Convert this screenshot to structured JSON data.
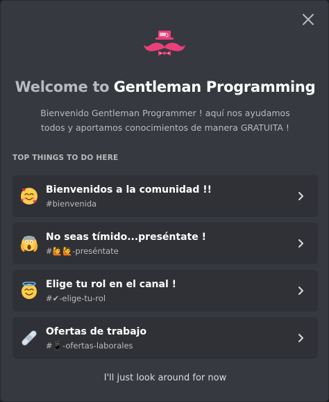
{
  "dialog": {
    "close_icon": "close-icon",
    "logo_icon": "gentleman-mustache-tophat-logo",
    "title_prefix": "Welcome to",
    "title_server": "Gentleman Programming",
    "description": "Bienvenido Gentleman Programmer ! aquí nos ayudamos todos y aportamos conocimientos de manera GRATUITA !",
    "section_header": "TOP THINGS TO DO HERE",
    "items": [
      {
        "title": "Bienvenidos a la comunidad !!",
        "channel": "#bienvenida",
        "emoji": "smiling-face-with-hearts-icon"
      },
      {
        "title": "No seas tímido...preséntate !",
        "channel": "#🙋🙋-preséntate",
        "emoji": "face-screaming-in-fear-icon"
      },
      {
        "title": "Elige tu rol en el canal !",
        "channel": "#✔-elige-tu-rol",
        "emoji": "smiling-face-with-halo-icon"
      },
      {
        "title": "Ofertas de trabajo",
        "channel": "#📱-ofertas-laborales",
        "emoji": "adhesive-bandage-icon"
      }
    ],
    "skip_label": "I'll just look around for now",
    "colors": {
      "background": "#36393f",
      "card": "#2f3136",
      "accent_pink": "#e9407a",
      "text_primary": "#ffffff",
      "text_muted": "#b9bbbe"
    }
  }
}
